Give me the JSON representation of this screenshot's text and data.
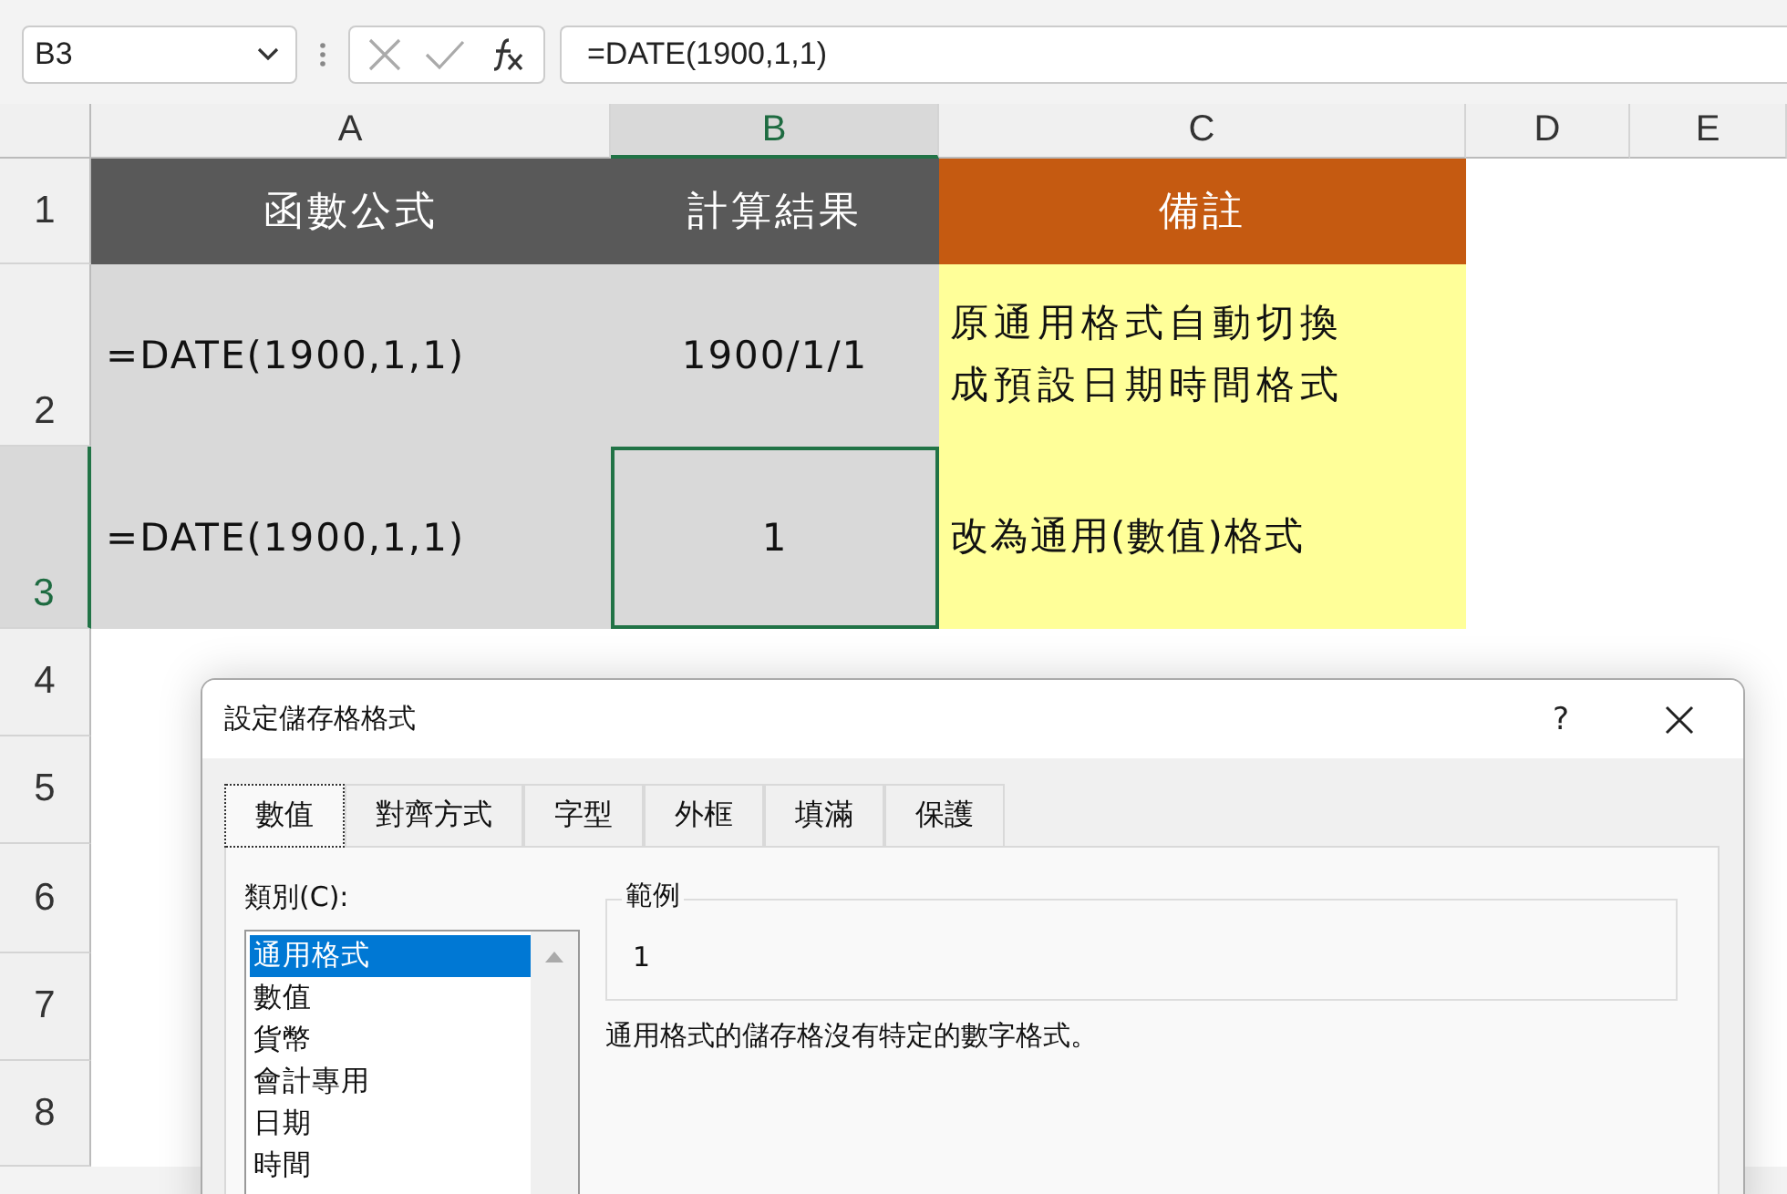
{
  "formula_bar": {
    "name_box": "B3",
    "formula": "=DATE(1900,1,1)"
  },
  "columns": [
    {
      "label": "A",
      "selected": false
    },
    {
      "label": "B",
      "selected": true
    },
    {
      "label": "C",
      "selected": false
    },
    {
      "label": "D",
      "selected": false
    },
    {
      "label": "E",
      "selected": false
    }
  ],
  "rows": [
    "1",
    "2",
    "3",
    "4",
    "5",
    "6",
    "7",
    "8"
  ],
  "table": {
    "header": [
      "函數公式",
      "計算結果",
      "備註"
    ],
    "rows": [
      {
        "cells": [
          "=DATE(1900,1,1)",
          "1900/1/1",
          "原通用格式自動切換成預設日期時間格式"
        ],
        "selected": false
      },
      {
        "cells": [
          "=DATE(1900,1,1)",
          "1",
          "改為通用(數值)格式"
        ],
        "selected": true
      }
    ]
  },
  "dialog": {
    "title": "設定儲存格格式",
    "help": "?",
    "tabs": [
      {
        "label": "數值",
        "selected": true
      },
      {
        "label": "對齊方式",
        "selected": false
      },
      {
        "label": "字型",
        "selected": false
      },
      {
        "label": "外框",
        "selected": false
      },
      {
        "label": "填滿",
        "selected": false
      },
      {
        "label": "保護",
        "selected": false
      }
    ],
    "category_label": "類別(C):",
    "categories": [
      {
        "label": "通用格式",
        "selected": true
      },
      {
        "label": "數值",
        "selected": false
      },
      {
        "label": "貨幣",
        "selected": false
      },
      {
        "label": "會計專用",
        "selected": false
      },
      {
        "label": "日期",
        "selected": false
      },
      {
        "label": "時間",
        "selected": false
      }
    ],
    "sample_label": "範例",
    "sample_value": "1",
    "description": "通用格式的儲存格沒有特定的數字格式。"
  }
}
